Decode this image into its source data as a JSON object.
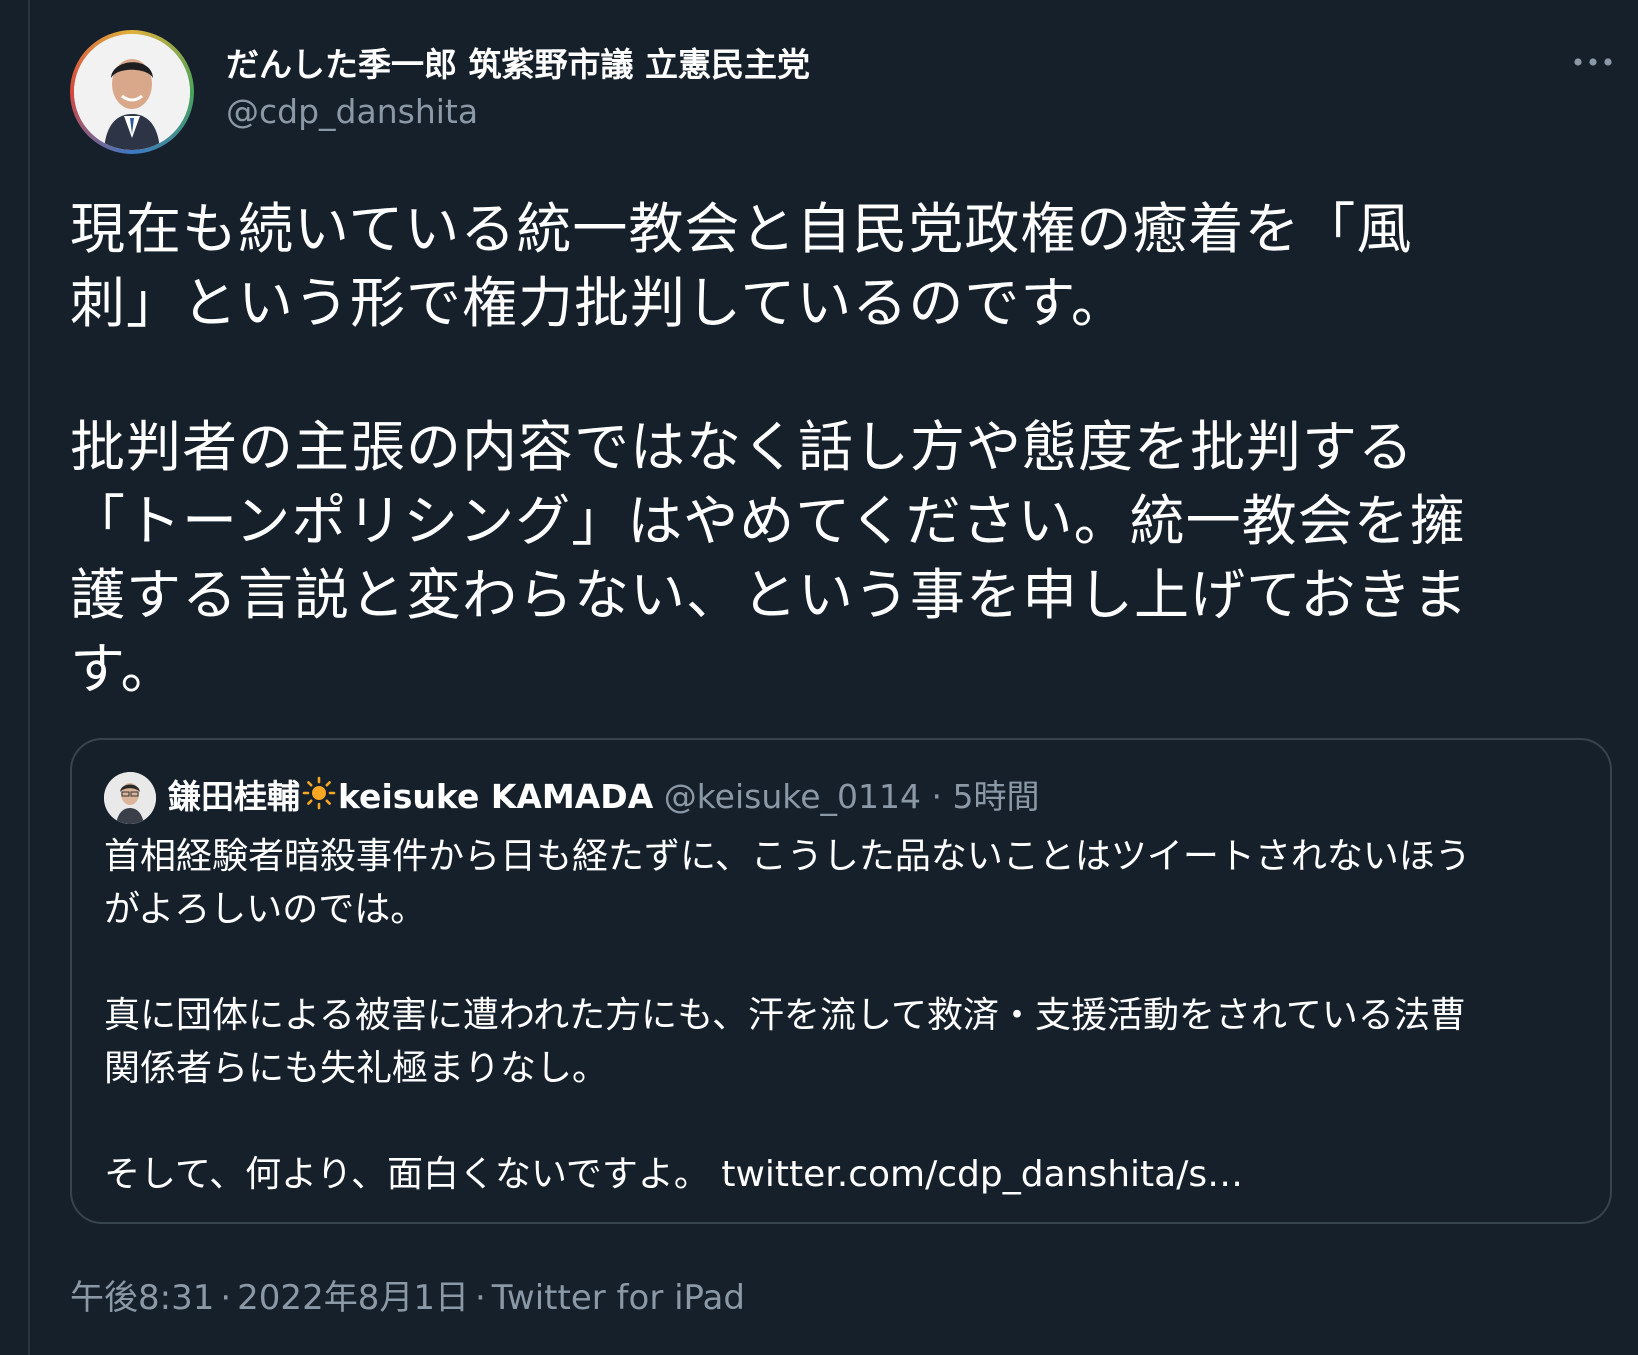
{
  "author": {
    "name": "だんした季一郎 筑紫野市議 立憲民主党",
    "handle": "@cdp_danshita"
  },
  "tweet": {
    "lines": [
      "現在も続いている統一教会と自民党政権の癒着を「風",
      "刺」という形で権力批判しているのです。",
      "",
      "批判者の主張の内容ではなく話し方や態度を批判する",
      "「トーンポリシング」はやめてください。統一教会を擁",
      "護する言説と変わらない、という事を申し上げておきま",
      "す。"
    ]
  },
  "quoted_tweet": {
    "name_prefix": "鎌田桂輔",
    "name_suffix": "keisuke KAMADA",
    "handle": "@keisuke_0114",
    "separator": "·",
    "time": "5時間",
    "lines": [
      "首相経験者暗殺事件から日も経たずに、こうした品ないことはツイートされないほう",
      "がよろしいのでは。",
      "",
      "真に団体による被害に遭われた方にも、汗を流して救済・支援活動をされている法曹",
      "関係者らにも失礼極まりなし。",
      "",
      "そして、何より、面白くないですよ。"
    ],
    "link": "twitter.com/cdp_danshita/s…"
  },
  "footer": {
    "time": "午後8:31",
    "separator": "·",
    "date": "2022年8月1日",
    "source": "Twitter for iPad"
  },
  "colors": {
    "background": "#16202b",
    "text": "#ffffff",
    "muted": "#8b98a5",
    "border": "#38444d",
    "sun": "#f5a623"
  },
  "icons": {
    "more": "more-horizontal-icon",
    "sun": "sun-emoji-icon"
  }
}
